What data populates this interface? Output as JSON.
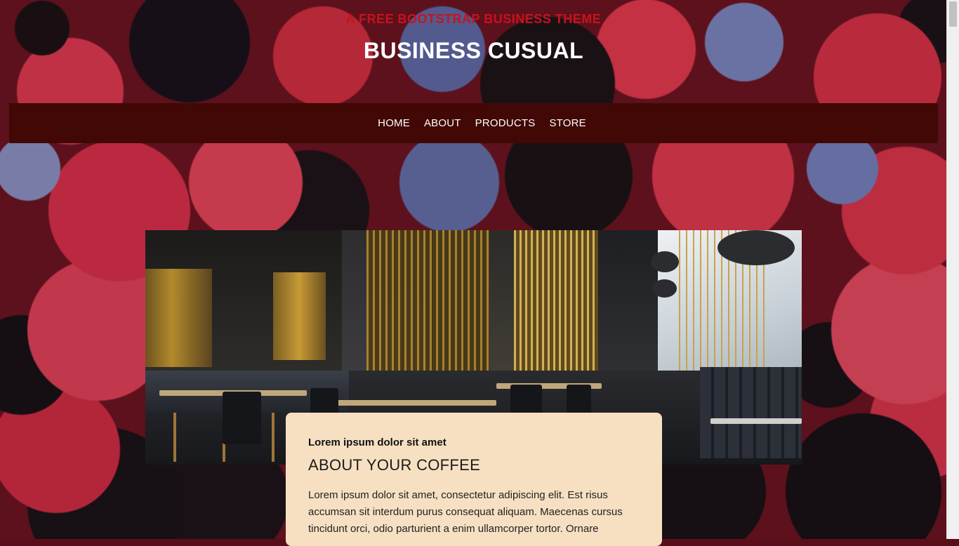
{
  "header": {
    "tagline": "A FREE BOOTSTRAP BUSINESS THEME",
    "title": "BUSINESS CUSUAL"
  },
  "nav": {
    "items": [
      {
        "label": "HOME"
      },
      {
        "label": "ABOUT"
      },
      {
        "label": "PRODUCTS"
      },
      {
        "label": "STORE"
      }
    ]
  },
  "intro": {
    "subtitle": "Lorem ipsum dolor sit amet",
    "title": "ABOUT YOUR COFFEE",
    "body": "Lorem ipsum dolor sit amet, consectetur adipiscing elit. Est risus accumsan sit interdum purus consequat aliquam. Maecenas cursus tincidunt orci, odio parturient a enim ullamcorper tortor. Ornare"
  },
  "colors": {
    "tagline": "#c8121d",
    "navbar": "#410805",
    "card": "#f7e0c2"
  }
}
